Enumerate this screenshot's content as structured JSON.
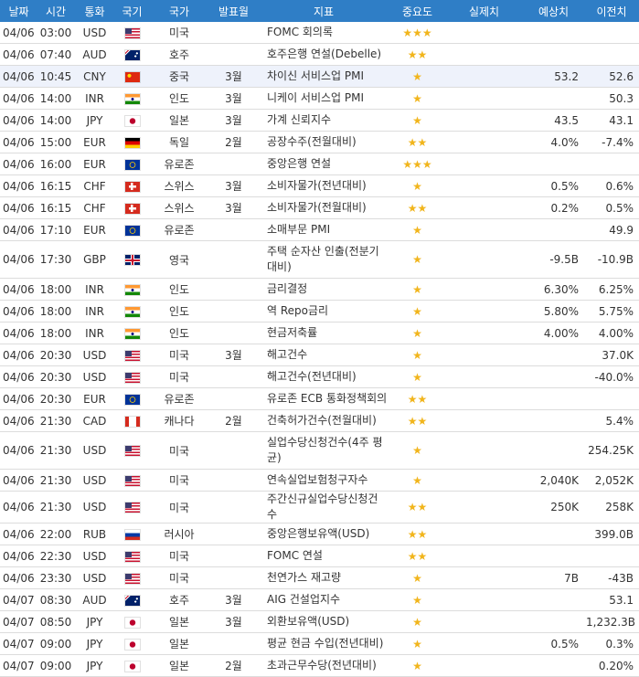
{
  "headers": [
    "날짜",
    "시간",
    "통화",
    "국기",
    "국가",
    "발표월",
    "지표",
    "중요도",
    "실제치",
    "예상치",
    "이전치"
  ],
  "rows": [
    {
      "date": "04/06",
      "time": "03:00",
      "cur": "USD",
      "flag": "us-flag",
      "country": "미국",
      "month": "",
      "indicator": "FOMC 회의록",
      "stars": "★★★",
      "actual": "",
      "forecast": "",
      "previous": ""
    },
    {
      "date": "04/06",
      "time": "07:40",
      "cur": "AUD",
      "flag": "au-flag",
      "country": "호주",
      "month": "",
      "indicator": "호주은행 연설(Debelle)",
      "stars": "★★",
      "actual": "",
      "forecast": "",
      "previous": ""
    },
    {
      "date": "04/06",
      "time": "10:45",
      "cur": "CNY",
      "flag": "cn-flag",
      "country": "중국",
      "month": "3월",
      "indicator": "차이신 서비스업 PMI",
      "stars": "★",
      "actual": "",
      "forecast": "53.2",
      "previous": "52.6"
    },
    {
      "date": "04/06",
      "time": "14:00",
      "cur": "INR",
      "flag": "in-flag",
      "country": "인도",
      "month": "3월",
      "indicator": "니케이 서비스업 PMI",
      "stars": "★",
      "actual": "",
      "forecast": "",
      "previous": "50.3"
    },
    {
      "date": "04/06",
      "time": "14:00",
      "cur": "JPY",
      "flag": "jp-flag",
      "country": "일본",
      "month": "3월",
      "indicator": "가계 신뢰지수",
      "stars": "★",
      "actual": "",
      "forecast": "43.5",
      "previous": "43.1"
    },
    {
      "date": "04/06",
      "time": "15:00",
      "cur": "EUR",
      "flag": "de-flag",
      "country": "독일",
      "month": "2월",
      "indicator": "공장수주(전월대비)",
      "stars": "★★",
      "actual": "",
      "forecast": "4.0%",
      "previous": "-7.4%"
    },
    {
      "date": "04/06",
      "time": "16:00",
      "cur": "EUR",
      "flag": "eu-flag",
      "country": "유로존",
      "month": "",
      "indicator": "중앙은행 연설",
      "stars": "★★★",
      "actual": "",
      "forecast": "",
      "previous": ""
    },
    {
      "date": "04/06",
      "time": "16:15",
      "cur": "CHF",
      "flag": "ch-flag",
      "country": "스위스",
      "month": "3월",
      "indicator": "소비자물가(전년대비)",
      "stars": "★",
      "actual": "",
      "forecast": "0.5%",
      "previous": "0.6%"
    },
    {
      "date": "04/06",
      "time": "16:15",
      "cur": "CHF",
      "flag": "ch-flag",
      "country": "스위스",
      "month": "3월",
      "indicator": "소비자물가(전월대비)",
      "stars": "★★",
      "actual": "",
      "forecast": "0.2%",
      "previous": "0.5%"
    },
    {
      "date": "04/06",
      "time": "17:10",
      "cur": "EUR",
      "flag": "eu-flag",
      "country": "유로존",
      "month": "",
      "indicator": "소매부문 PMI",
      "stars": "★",
      "actual": "",
      "forecast": "",
      "previous": "49.9"
    },
    {
      "date": "04/06",
      "time": "17:30",
      "cur": "GBP",
      "flag": "gb-flag",
      "country": "영국",
      "month": "",
      "indicator": "주택 순자산 인출(전분기대비)",
      "stars": "★",
      "actual": "",
      "forecast": "-9.5B",
      "previous": "-10.9B",
      "tall": true
    },
    {
      "date": "04/06",
      "time": "18:00",
      "cur": "INR",
      "flag": "in-flag",
      "country": "인도",
      "month": "",
      "indicator": "금리결정",
      "stars": "★",
      "actual": "",
      "forecast": "6.30%",
      "previous": "6.25%"
    },
    {
      "date": "04/06",
      "time": "18:00",
      "cur": "INR",
      "flag": "in-flag",
      "country": "인도",
      "month": "",
      "indicator": "역 Repo금리",
      "stars": "★",
      "actual": "",
      "forecast": "5.80%",
      "previous": "5.75%"
    },
    {
      "date": "04/06",
      "time": "18:00",
      "cur": "INR",
      "flag": "in-flag",
      "country": "인도",
      "month": "",
      "indicator": "현금저축률",
      "stars": "★",
      "actual": "",
      "forecast": "4.00%",
      "previous": "4.00%"
    },
    {
      "date": "04/06",
      "time": "20:30",
      "cur": "USD",
      "flag": "us-flag",
      "country": "미국",
      "month": "3월",
      "indicator": "해고건수",
      "stars": "★",
      "actual": "",
      "forecast": "",
      "previous": "37.0K"
    },
    {
      "date": "04/06",
      "time": "20:30",
      "cur": "USD",
      "flag": "us-flag",
      "country": "미국",
      "month": "",
      "indicator": "해고건수(전년대비)",
      "stars": "★",
      "actual": "",
      "forecast": "",
      "previous": "-40.0%"
    },
    {
      "date": "04/06",
      "time": "20:30",
      "cur": "EUR",
      "flag": "eu-flag",
      "country": "유로존",
      "month": "",
      "indicator": "유로존 ECB 통화정책회의",
      "stars": "★★",
      "actual": "",
      "forecast": "",
      "previous": ""
    },
    {
      "date": "04/06",
      "time": "21:30",
      "cur": "CAD",
      "flag": "ca-flag",
      "country": "캐나다",
      "month": "2월",
      "indicator": "건축허가건수(전월대비)",
      "stars": "★★",
      "actual": "",
      "forecast": "",
      "previous": "5.4%"
    },
    {
      "date": "04/06",
      "time": "21:30",
      "cur": "USD",
      "flag": "us-flag",
      "country": "미국",
      "month": "",
      "indicator": "실업수당신청건수(4주 평균)",
      "stars": "★",
      "actual": "",
      "forecast": "",
      "previous": "254.25K",
      "tall": true
    },
    {
      "date": "04/06",
      "time": "21:30",
      "cur": "USD",
      "flag": "us-flag",
      "country": "미국",
      "month": "",
      "indicator": "연속실업보험청구자수",
      "stars": "★",
      "actual": "",
      "forecast": "2,040K",
      "previous": "2,052K"
    },
    {
      "date": "04/06",
      "time": "21:30",
      "cur": "USD",
      "flag": "us-flag",
      "country": "미국",
      "month": "",
      "indicator": "주간신규실업수당신청건수",
      "stars": "★★",
      "actual": "",
      "forecast": "250K",
      "previous": "258K"
    },
    {
      "date": "04/06",
      "time": "22:00",
      "cur": "RUB",
      "flag": "ru-flag",
      "country": "러시아",
      "month": "",
      "indicator": "중앙은행보유액(USD)",
      "stars": "★★",
      "actual": "",
      "forecast": "",
      "previous": "399.0B"
    },
    {
      "date": "04/06",
      "time": "22:30",
      "cur": "USD",
      "flag": "us-flag",
      "country": "미국",
      "month": "",
      "indicator": "FOMC 연설",
      "stars": "★★",
      "actual": "",
      "forecast": "",
      "previous": ""
    },
    {
      "date": "04/06",
      "time": "23:30",
      "cur": "USD",
      "flag": "us-flag",
      "country": "미국",
      "month": "",
      "indicator": "천연가스 재고량",
      "stars": "★",
      "actual": "",
      "forecast": "7B",
      "previous": "-43B"
    },
    {
      "date": "04/07",
      "time": "08:30",
      "cur": "AUD",
      "flag": "au-flag",
      "country": "호주",
      "month": "3월",
      "indicator": "AIG 건설업지수",
      "stars": "★",
      "actual": "",
      "forecast": "",
      "previous": "53.1"
    },
    {
      "date": "04/07",
      "time": "08:50",
      "cur": "JPY",
      "flag": "jp-flag",
      "country": "일본",
      "month": "3월",
      "indicator": "외환보유액(USD)",
      "stars": "★",
      "actual": "",
      "forecast": "",
      "previous": "1,232.3B"
    },
    {
      "date": "04/07",
      "time": "09:00",
      "cur": "JPY",
      "flag": "jp-flag",
      "country": "일본",
      "month": "",
      "indicator": "평균 현금 수입(전년대비)",
      "stars": "★",
      "actual": "",
      "forecast": "0.5%",
      "previous": "0.3%"
    },
    {
      "date": "04/07",
      "time": "09:00",
      "cur": "JPY",
      "flag": "jp-flag",
      "country": "일본",
      "month": "2월",
      "indicator": "초과근무수당(전년대비)",
      "stars": "★",
      "actual": "",
      "forecast": "",
      "previous": "0.20%"
    }
  ],
  "highlight_row": 2
}
